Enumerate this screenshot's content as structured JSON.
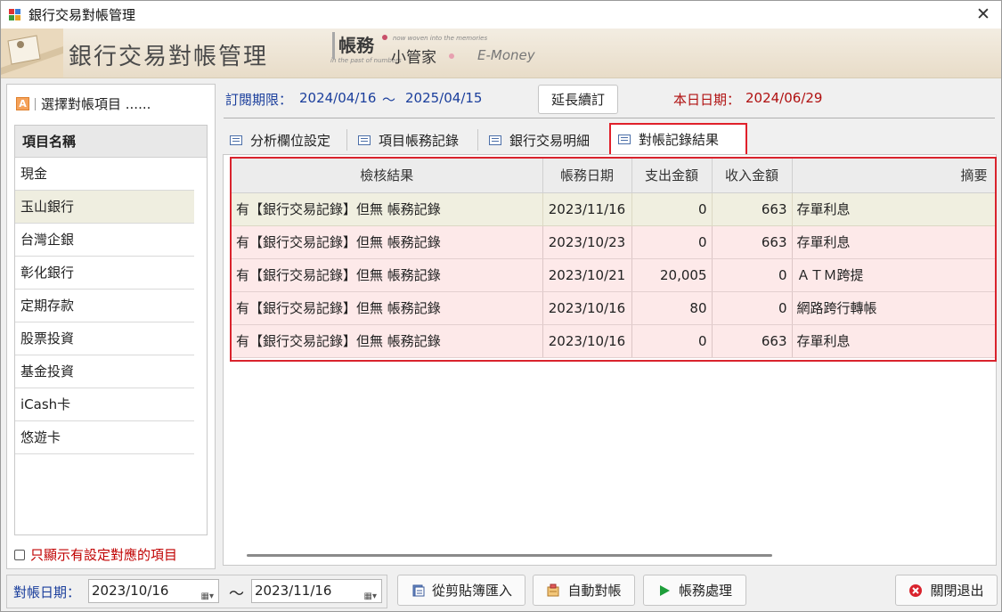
{
  "window": {
    "title": "銀行交易對帳管理",
    "close_glyph": "✕"
  },
  "banner": {
    "title": "銀行交易對帳管理",
    "brand": "帳務",
    "brand_name": "小管家",
    "brand_tagline_top": "now woven into the memories",
    "brand_tagline_bottom": "in the past of numbers",
    "emoney": "E-Money"
  },
  "left": {
    "header": "選擇對帳項目 ......",
    "a_icon": "A",
    "list_header": "項目名稱",
    "items": [
      "現金",
      "玉山銀行",
      "台灣企銀",
      "彰化銀行",
      "定期存款",
      "股票投資",
      "基金投資",
      "iCash卡",
      "悠遊卡"
    ],
    "selected_index": 1,
    "only_show_label": "只顯示有設定對應的項目"
  },
  "subscription": {
    "label": "訂閱期限：",
    "start": "2024/04/16",
    "tilde": "～",
    "end": "2025/04/15",
    "renew_button": "延長續訂",
    "today_label": "本日日期：",
    "today": "2024/06/29"
  },
  "tabs": [
    "分析欄位設定",
    "項目帳務記錄",
    "銀行交易明細",
    "對帳記錄結果"
  ],
  "active_tab": 3,
  "grid": {
    "columns": [
      "檢核結果",
      "帳務日期",
      "支出金額",
      "收入金額",
      "摘要"
    ],
    "rows": [
      [
        "有【銀行交易記錄】但無 帳務記錄",
        "2023/11/16",
        "0",
        "663",
        "存單利息"
      ],
      [
        "有【銀行交易記錄】但無 帳務記錄",
        "2023/10/23",
        "0",
        "663",
        "存單利息"
      ],
      [
        "有【銀行交易記錄】但無 帳務記錄",
        "2023/10/21",
        "20,005",
        "0",
        "ＡＴＭ跨提"
      ],
      [
        "有【銀行交易記錄】但無 帳務記錄",
        "2023/10/16",
        "80",
        "0",
        "網路跨行轉帳"
      ],
      [
        "有【銀行交易記錄】但無 帳務記錄",
        "2023/10/16",
        "0",
        "663",
        "存單利息"
      ]
    ]
  },
  "bottom": {
    "date_label": "對帳日期：",
    "date_from": "2023/10/16",
    "tilde": "～",
    "date_to": "2023/11/16",
    "import_button": "從剪貼簿匯入",
    "auto_button": "自動對帳",
    "process_button": "帳務處理",
    "exit_button": "關閉退出"
  },
  "colors": {
    "accent_red": "#d9232d",
    "label_blue": "#1a3e9c",
    "row_pink": "#fde9e9",
    "row_selected": "#f0efe0"
  }
}
